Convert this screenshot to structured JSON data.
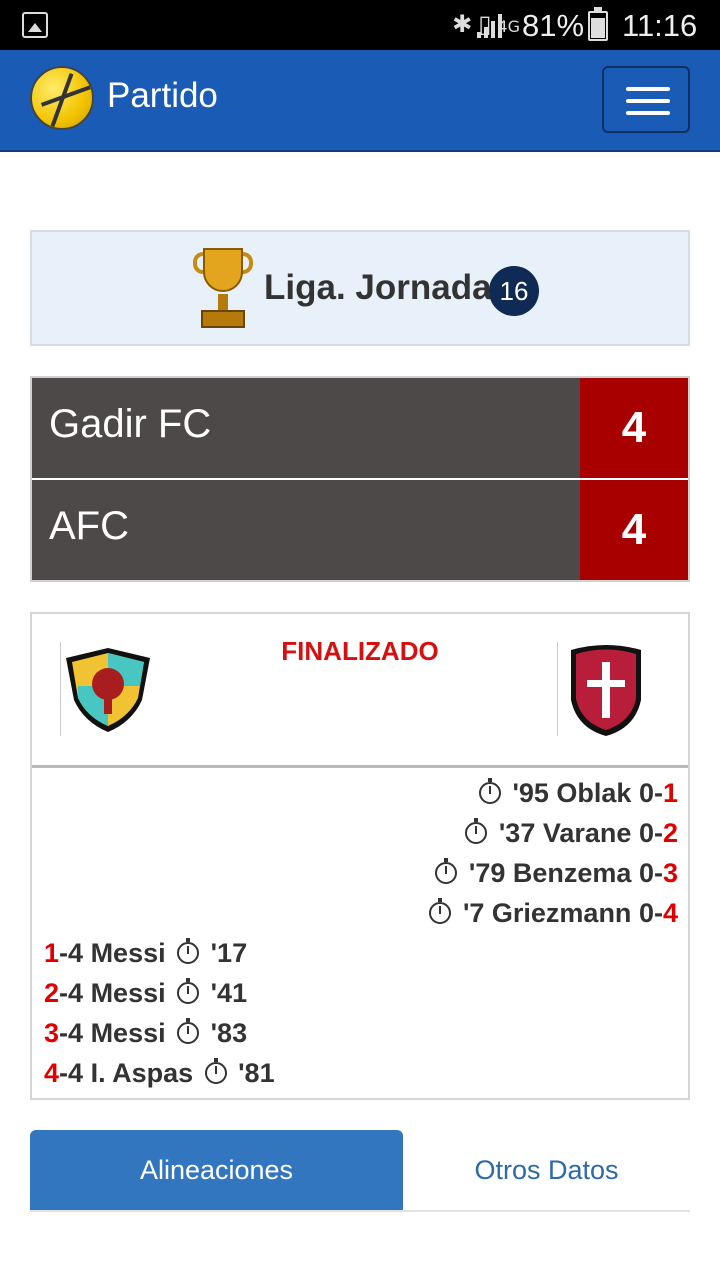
{
  "status_bar": {
    "icons": [
      "gallery-icon",
      "bluetooth-icon",
      "vibrate-icon",
      "4g-icon",
      "signal-icon"
    ],
    "network": "4G",
    "battery": "81%",
    "time": "11:16"
  },
  "navbar": {
    "title": "Partido",
    "menu_icon": "hamburger-icon"
  },
  "league": {
    "label": "Liga. Jornada",
    "round": "16"
  },
  "score": {
    "home": {
      "team": "Gadir FC",
      "goals": "4"
    },
    "away": {
      "team": "AFC",
      "goals": "4"
    }
  },
  "match": {
    "status": "FINALIZADO",
    "away_events": [
      {
        "minute": "'95",
        "player": "Oblak",
        "score_prefix": "0-",
        "score_highlight": "1"
      },
      {
        "minute": "'37",
        "player": "Varane",
        "score_prefix": "0-",
        "score_highlight": "2"
      },
      {
        "minute": "'79",
        "player": "Benzema",
        "score_prefix": "0-",
        "score_highlight": "3"
      },
      {
        "minute": "'7",
        "player": "Griezmann",
        "score_prefix": "0-",
        "score_highlight": "4"
      }
    ],
    "home_events": [
      {
        "score_highlight": "1",
        "score_suffix": "-4",
        "player": "Messi",
        "minute": "'17"
      },
      {
        "score_highlight": "2",
        "score_suffix": "-4",
        "player": "Messi",
        "minute": "'41"
      },
      {
        "score_highlight": "3",
        "score_suffix": "-4",
        "player": "Messi",
        "minute": "'83"
      },
      {
        "score_highlight": "4",
        "score_suffix": "-4",
        "player": "I. Aspas",
        "minute": "'81"
      }
    ]
  },
  "tabs": {
    "lineups": "Alineaciones",
    "other": "Otros Datos"
  },
  "colors": {
    "navbar": "#1a5bb5",
    "score_box": "#a80000",
    "team_row": "#4d4949",
    "status": "#d41010",
    "active_tab": "#3276bf"
  }
}
